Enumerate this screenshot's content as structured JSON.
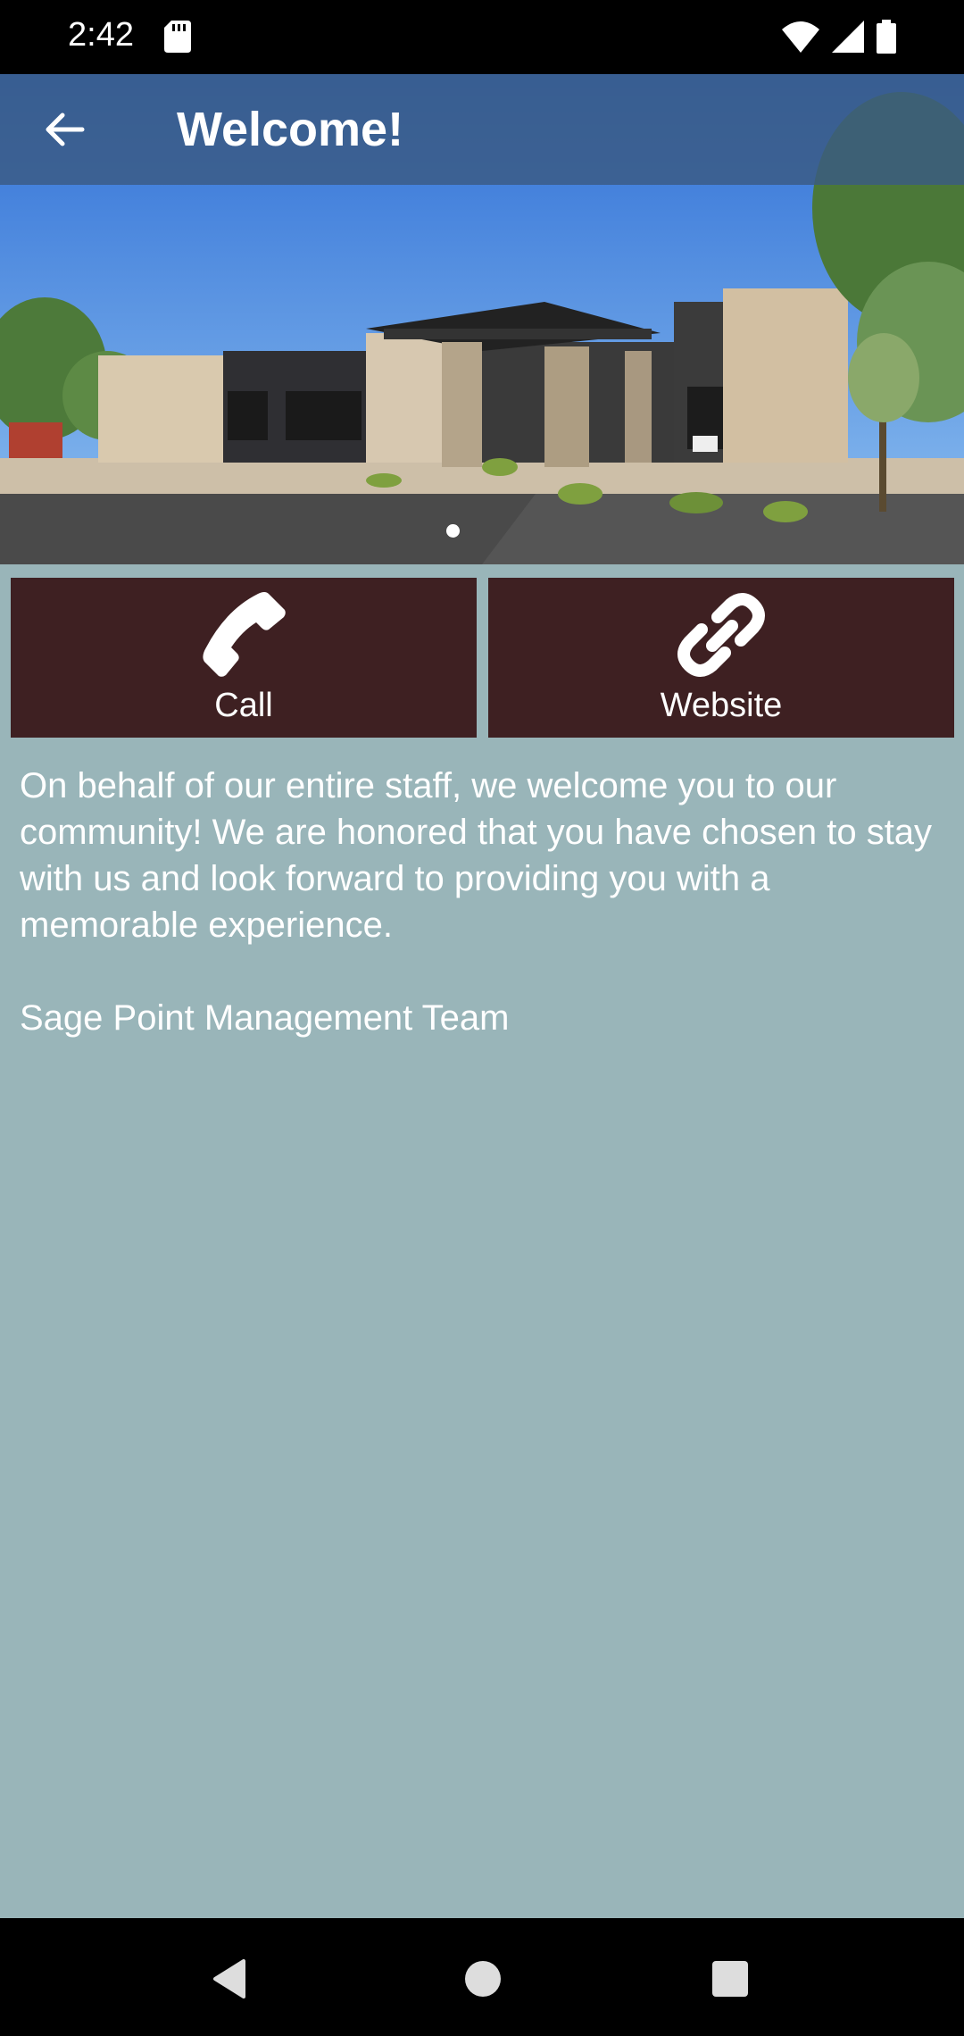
{
  "status_bar": {
    "time": "2:42",
    "icons": [
      "sd-card-icon",
      "wifi-icon",
      "signal-icon",
      "battery-icon"
    ]
  },
  "app_bar": {
    "title": "Welcome!",
    "back_icon": "arrow-back-icon"
  },
  "hero": {
    "image_description_icon": "building-photo",
    "page_indicator_count": 1,
    "page_indicator_active": 1
  },
  "actions": {
    "call": {
      "label": "Call",
      "icon": "phone-icon"
    },
    "website": {
      "label": "Website",
      "icon": "link-icon"
    }
  },
  "content": {
    "message": "On behalf of our entire staff, we welcome you to our community! We are honored that you have chosen to stay with us and look forward to providing you with a memorable experience.",
    "signature": "Sage Point Management Team"
  },
  "colors": {
    "background": "#99b5b9",
    "button": "#3e2022",
    "app_bar": "#3a5a82",
    "text": "#ffffff"
  },
  "nav_bar": {
    "icons": [
      "nav-back-icon",
      "nav-home-icon",
      "nav-recents-icon"
    ]
  }
}
